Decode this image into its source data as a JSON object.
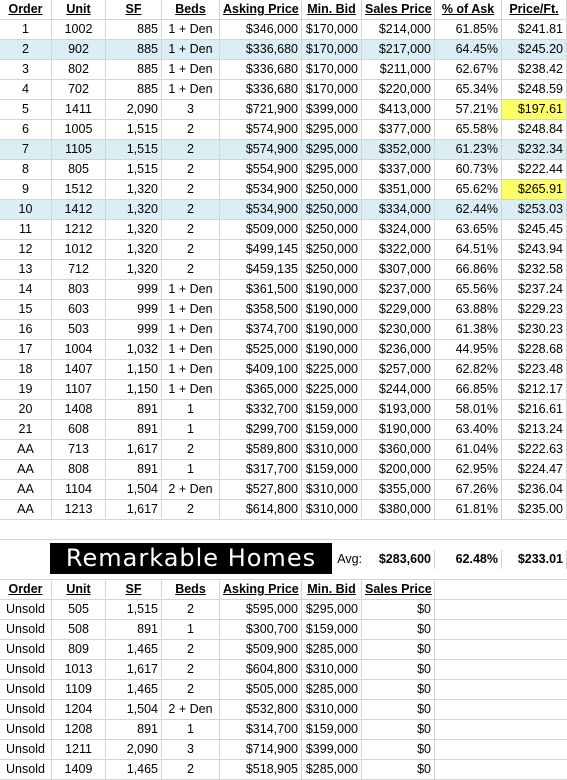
{
  "sold_headers": [
    "Order",
    "Unit",
    "SF",
    "Beds",
    "Asking Price",
    "Min. Bid",
    "Sales Price",
    "% of Ask",
    "Price/Ft."
  ],
  "sold_rows": [
    [
      "1",
      "1002",
      "885",
      "1 + Den",
      "$346,000",
      "$170,000",
      "$214,000",
      "61.85%",
      "$241.81"
    ],
    [
      "2",
      "902",
      "885",
      "1 + Den",
      "$336,680",
      "$170,000",
      "$217,000",
      "64.45%",
      "$245.20"
    ],
    [
      "3",
      "802",
      "885",
      "1 + Den",
      "$336,680",
      "$170,000",
      "$211,000",
      "62.67%",
      "$238.42"
    ],
    [
      "4",
      "702",
      "885",
      "1 + Den",
      "$336,680",
      "$170,000",
      "$220,000",
      "65.34%",
      "$248.59"
    ],
    [
      "5",
      "1411",
      "2,090",
      "3",
      "$721,900",
      "$399,000",
      "$413,000",
      "57.21%",
      "$197.61"
    ],
    [
      "6",
      "1005",
      "1,515",
      "2",
      "$574,900",
      "$295,000",
      "$377,000",
      "65.58%",
      "$248.84"
    ],
    [
      "7",
      "1105",
      "1,515",
      "2",
      "$574,900",
      "$295,000",
      "$352,000",
      "61.23%",
      "$232.34"
    ],
    [
      "8",
      "805",
      "1,515",
      "2",
      "$554,900",
      "$295,000",
      "$337,000",
      "60.73%",
      "$222.44"
    ],
    [
      "9",
      "1512",
      "1,320",
      "2",
      "$534,900",
      "$250,000",
      "$351,000",
      "65.62%",
      "$265.91"
    ],
    [
      "10",
      "1412",
      "1,320",
      "2",
      "$534,900",
      "$250,000",
      "$334,000",
      "62.44%",
      "$253.03"
    ],
    [
      "11",
      "1212",
      "1,320",
      "2",
      "$509,000",
      "$250,000",
      "$324,000",
      "63.65%",
      "$245.45"
    ],
    [
      "12",
      "1012",
      "1,320",
      "2",
      "$499,145",
      "$250,000",
      "$322,000",
      "64.51%",
      "$243.94"
    ],
    [
      "13",
      "712",
      "1,320",
      "2",
      "$459,135",
      "$250,000",
      "$307,000",
      "66.86%",
      "$232.58"
    ],
    [
      "14",
      "803",
      "999",
      "1 + Den",
      "$361,500",
      "$190,000",
      "$237,000",
      "65.56%",
      "$237.24"
    ],
    [
      "15",
      "603",
      "999",
      "1 + Den",
      "$358,500",
      "$190,000",
      "$229,000",
      "63.88%",
      "$229.23"
    ],
    [
      "16",
      "503",
      "999",
      "1 + Den",
      "$374,700",
      "$190,000",
      "$230,000",
      "61.38%",
      "$230.23"
    ],
    [
      "17",
      "1004",
      "1,032",
      "1 + Den",
      "$525,000",
      "$190,000",
      "$236,000",
      "44.95%",
      "$228.68"
    ],
    [
      "18",
      "1407",
      "1,150",
      "1 + Den",
      "$409,100",
      "$225,000",
      "$257,000",
      "62.82%",
      "$223.48"
    ],
    [
      "19",
      "1107",
      "1,150",
      "1 + Den",
      "$365,000",
      "$225,000",
      "$244,000",
      "66.85%",
      "$212.17"
    ],
    [
      "20",
      "1408",
      "891",
      "1",
      "$332,700",
      "$159,000",
      "$193,000",
      "58.01%",
      "$216.61"
    ],
    [
      "21",
      "608",
      "891",
      "1",
      "$299,700",
      "$159,000",
      "$190,000",
      "63.40%",
      "$213.24"
    ],
    [
      "AA",
      "713",
      "1,617",
      "2",
      "$589,800",
      "$310,000",
      "$360,000",
      "61.04%",
      "$222.63"
    ],
    [
      "AA",
      "808",
      "891",
      "1",
      "$317,700",
      "$159,000",
      "$200,000",
      "62.95%",
      "$224.47"
    ],
    [
      "AA",
      "1104",
      "1,504",
      "2 + Den",
      "$527,800",
      "$310,000",
      "$355,000",
      "67.26%",
      "$236.04"
    ],
    [
      "AA",
      "1213",
      "1,617",
      "2",
      "$614,800",
      "$310,000",
      "$380,000",
      "61.81%",
      "$235.00"
    ]
  ],
  "highlighted_rows": [
    1,
    6,
    9
  ],
  "yellow_cells": [
    4,
    8
  ],
  "logo_text": "Remarkable Homes",
  "avg": {
    "label": "Avg:",
    "sales": "$283,600",
    "pct": "62.48%",
    "ppf": "$233.01"
  },
  "unsold_headers": [
    "Order",
    "Unit",
    "SF",
    "Beds",
    "Asking Price",
    "Min. Bid",
    "Sales Price"
  ],
  "unsold_rows": [
    [
      "Unsold",
      "505",
      "1,515",
      "2",
      "$595,000",
      "$295,000",
      "$0"
    ],
    [
      "Unsold",
      "508",
      "891",
      "1",
      "$300,700",
      "$159,000",
      "$0"
    ],
    [
      "Unsold",
      "809",
      "1,465",
      "2",
      "$509,900",
      "$285,000",
      "$0"
    ],
    [
      "Unsold",
      "1013",
      "1,617",
      "2",
      "$604,800",
      "$310,000",
      "$0"
    ],
    [
      "Unsold",
      "1109",
      "1,465",
      "2",
      "$505,000",
      "$285,000",
      "$0"
    ],
    [
      "Unsold",
      "1204",
      "1,504",
      "2 + Den",
      "$532,800",
      "$310,000",
      "$0"
    ],
    [
      "Unsold",
      "1208",
      "891",
      "1",
      "$314,700",
      "$159,000",
      "$0"
    ],
    [
      "Unsold",
      "1211",
      "2,090",
      "3",
      "$714,900",
      "$399,000",
      "$0"
    ],
    [
      "Unsold",
      "1409",
      "1,465",
      "2",
      "$518,905",
      "$285,000",
      "$0"
    ]
  ],
  "colors": {
    "highlight": "#daeef3",
    "yellow": "#ffff66",
    "grid": "#d4d4d4"
  }
}
